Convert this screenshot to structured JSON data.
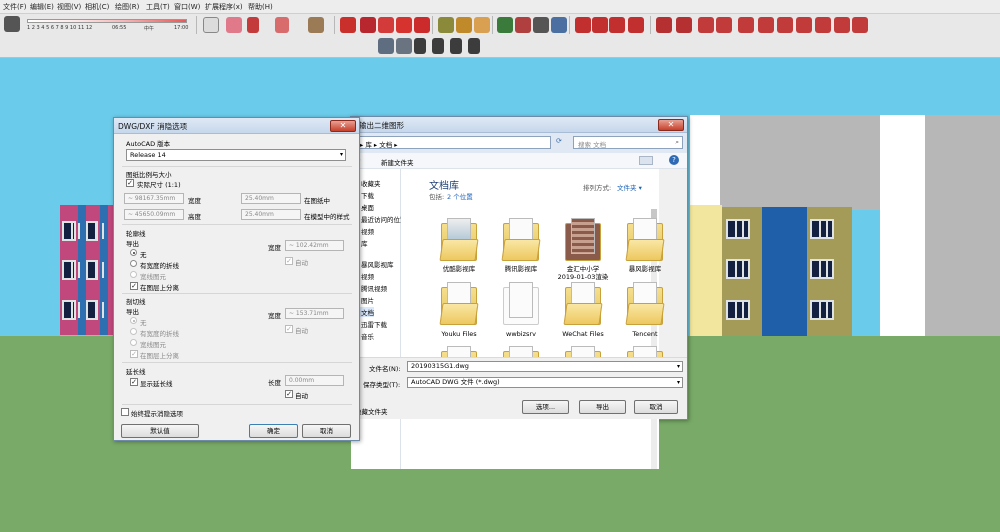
{
  "menu": [
    "文件(F)",
    "编辑(E)",
    "视图(V)",
    "相机(C)",
    "绘图(R)",
    "工具(T)",
    "窗口(W)",
    "扩展程序(x)",
    "帮助(H)"
  ],
  "sunbar": {
    "months": "1 2 3 4 5 6 7 8 9 10 11 12",
    "t1": "06:55",
    "t2": "中午",
    "t3": "17:00"
  },
  "dxf": {
    "title": "DWG/DXF 消隐选项",
    "close": "✕",
    "acad_label": "AutoCAD 版本",
    "acad_value": "Release 14",
    "scale_label": "图纸比例与大小",
    "real_size": "实际尺寸 (1:1)",
    "w_in_model": "~ 98167.35mm",
    "w_label": "宽度",
    "w_on_paper": "25.40mm",
    "paper_label": "在图纸中",
    "h_in_model": "~ 45650.09mm",
    "h_label": "高度",
    "h_on_paper": "25.40mm",
    "model_label": "在模型中的样式",
    "profile_label": "轮廓线",
    "export_label": "导出",
    "p_none": "无",
    "p_wide": "有宽度的折线",
    "p_entity": "宽线图元",
    "p_sep": "在图层上分离",
    "p_width_label": "宽度",
    "p_width_value": "~ 102.42mm",
    "p_auto": "自动",
    "section_label": "剖切线",
    "s_export_label": "导出",
    "s_none": "无",
    "s_wide": "有宽度的折线",
    "s_entity": "宽线图元",
    "s_sep": "在图层上分离",
    "s_width_label": "宽度",
    "s_width_value": "~ 153.71mm",
    "s_auto": "自动",
    "ext_label": "延长线",
    "ext_show": "显示延长线",
    "ext_len_label": "长度",
    "ext_len_value": "0.00mm",
    "ext_auto": "自动",
    "always": "始终提示消隐选项",
    "defaults": "默认值",
    "ok": "确定",
    "cancel": "取消"
  },
  "save": {
    "title": "输出二维图形",
    "path": "▸ 库 ▸ 文档 ▸",
    "search": "搜索 文档",
    "new_folder": "新建文件夹",
    "organize": "▾",
    "lib_title": "文档库",
    "includes": "包括:",
    "locations": "2 个位置",
    "sort_label": "排列方式:",
    "sort_value": "文件夹 ▾",
    "tree": [
      "收藏夹",
      "下载",
      "桌面",
      "最近访问的位置",
      "视频",
      "库",
      "",
      "暴风影视库",
      "视频",
      "腾讯视频",
      "图片",
      "文档",
      "迅雷下载",
      "音乐"
    ],
    "files": [
      "优酷影视库",
      "腾讯影视库",
      "金汇中小学\n2019-01-03渲染",
      "暴风影视库",
      "Youku Files",
      "wwbizsrv",
      "WeChat Files",
      "Tencent",
      "",
      "",
      "",
      ""
    ],
    "filename_label": "文件名(N):",
    "filename": "20190315G1.dwg",
    "type_label": "保存类型(T):",
    "type_value": "AutoCAD DWG 文件 (*.dwg)",
    "hide_folders": "隐藏文件夹",
    "options": "选项...",
    "export": "导出",
    "cancel": "取消"
  }
}
